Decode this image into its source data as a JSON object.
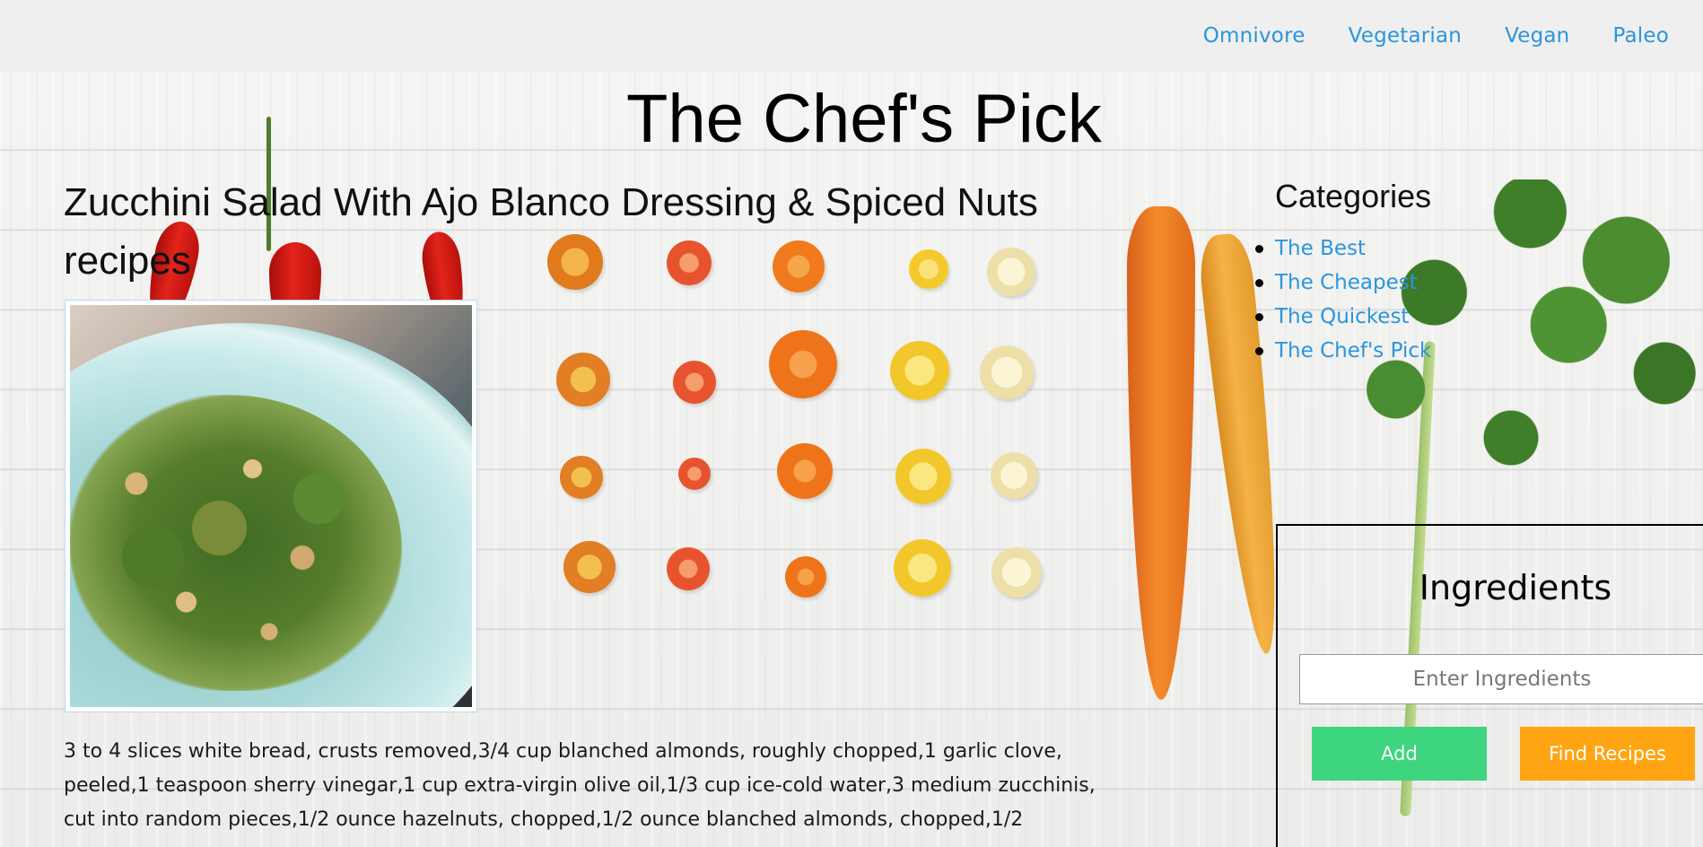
{
  "nav": {
    "items": [
      {
        "label": "Omnivore"
      },
      {
        "label": "Vegetarian"
      },
      {
        "label": "Vegan"
      },
      {
        "label": "Paleo"
      }
    ]
  },
  "site": {
    "title": "The Chef's Pick"
  },
  "recipe": {
    "title": "Zucchini Salad With Ajo Blanco Dressing & Spiced Nuts recipes",
    "ingredients": "3 to 4 slices white bread, crusts removed,3/4 cup blanched almonds, roughly chopped,1 garlic clove, peeled,1 teaspoon sherry vinegar,1 cup extra-virgin olive oil,1/3 cup ice-cold water,3 medium zucchinis, cut into random pieces,1/2 ounce hazelnuts, chopped,1/2 ounce blanched almonds, chopped,1/2"
  },
  "sidebar": {
    "categories_title": "Categories",
    "categories": [
      {
        "label": "The Best"
      },
      {
        "label": "The Cheapest"
      },
      {
        "label": "The Quickest"
      },
      {
        "label": "The Chef's Pick"
      }
    ],
    "ingredients_panel": {
      "title": "Ingredients",
      "input_placeholder": "Enter Ingredients",
      "input_value": "",
      "add_label": "Add",
      "find_label": "Find Recipes"
    }
  },
  "colors": {
    "link": "#2b95dc",
    "add_button": "#3dd67e",
    "find_button": "#ffa513"
  }
}
